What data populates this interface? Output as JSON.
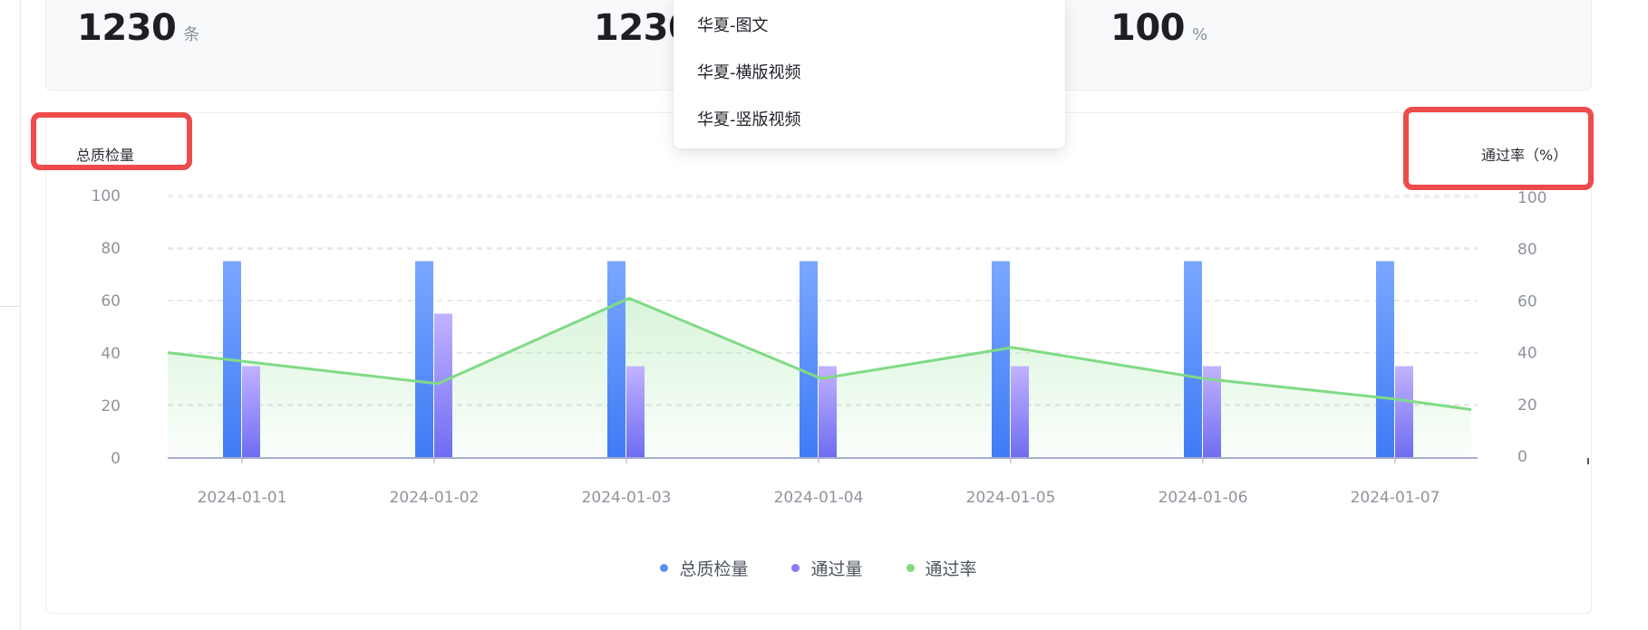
{
  "stats": [
    {
      "value": "1230",
      "unit": "条"
    },
    {
      "value": "1230",
      "unit": ""
    },
    {
      "value": "100",
      "unit": "%"
    }
  ],
  "dropdown": {
    "options": [
      "华夏-图文",
      "华夏-横版视频",
      "华夏-竖版视频"
    ]
  },
  "chart": {
    "left_axis_title": "总质检量",
    "right_axis_title": "通过率（%）",
    "legend": [
      {
        "label": "总质检量",
        "color": "#5b8ff9"
      },
      {
        "label": "通过量",
        "color": "#8b7cf6"
      },
      {
        "label": "通过率",
        "color": "#7fdb85"
      }
    ]
  },
  "chart_data": {
    "type": "bar",
    "categories": [
      "2024-01-01",
      "2024-01-02",
      "2024-01-03",
      "2024-01-04",
      "2024-01-05",
      "2024-01-06",
      "2024-01-07"
    ],
    "series": [
      {
        "name": "总质检量",
        "type": "bar",
        "axis": "left",
        "values": [
          75,
          75,
          75,
          75,
          75,
          75,
          75
        ]
      },
      {
        "name": "通过量",
        "type": "bar",
        "axis": "left",
        "values": [
          35,
          55,
          35,
          35,
          35,
          35,
          35
        ]
      },
      {
        "name": "通过率",
        "type": "line",
        "axis": "right",
        "area": true,
        "values": [
          40,
          28,
          61,
          30,
          42,
          30,
          22
        ]
      }
    ],
    "line_extends_to_right_edge_value": 18,
    "ylim_left": [
      0,
      100
    ],
    "ylim_right": [
      0,
      100
    ],
    "yticks_left": [
      "0",
      "20",
      "40",
      "60",
      "80",
      "100"
    ],
    "yticks_right": [
      "0",
      "20",
      "40",
      "60",
      "80",
      "100"
    ],
    "grid": true,
    "legend_position": "bottom-center"
  },
  "colors": {
    "bar_total_top": "#7aa7ff",
    "bar_total_bottom": "#3f7bf5",
    "bar_pass_top": "#c2b2ff",
    "bar_pass_bottom": "#6f6cf2",
    "line": "#7fdb85",
    "highlight": "#ee4b4b"
  }
}
